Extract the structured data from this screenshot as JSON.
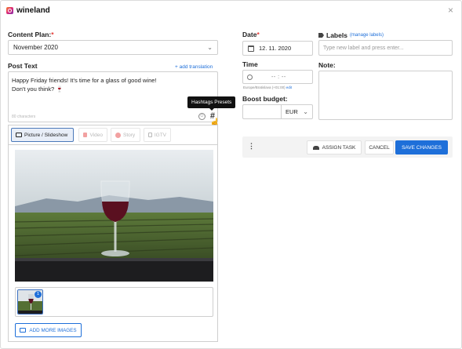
{
  "header": {
    "brand_icon": "instagram-icon",
    "brand_name": "wineland",
    "close_icon": "close-icon",
    "close_glyph": "×"
  },
  "content_plan": {
    "label": "Content Plan:",
    "required_mark": "*",
    "value": "November 2020"
  },
  "post_text": {
    "label": "Post Text",
    "add_translation": "+ add translation",
    "line1": "Happy Friday friends! It's time for a glass of good wine!",
    "line2": "Don't you think? 🍷",
    "char_count": "80 characters",
    "emoji_icon": "emoji-icon",
    "hashtag_icon": "hashtag-icon",
    "hashtag_glyph": "#",
    "tooltip": "Hashtags Presets"
  },
  "media_tabs": [
    {
      "label": "Picture / Slideshow",
      "active": true,
      "icon": "image-icon"
    },
    {
      "label": "Video",
      "active": false,
      "icon": "video-icon"
    },
    {
      "label": "Story",
      "active": false,
      "icon": "story-icon"
    },
    {
      "label": "IGTV",
      "active": false,
      "icon": "igtv-icon"
    }
  ],
  "media": {
    "thumb_badge": "1",
    "add_more_label": "ADD MORE IMAGES"
  },
  "date": {
    "label": "Date",
    "required_mark": "*",
    "value": "12. 11. 2020"
  },
  "time": {
    "label": "Time",
    "value": "-- : --",
    "timezone": "Europe/Bratislava (+01:00)",
    "timezone_edit": "edit"
  },
  "budget": {
    "label": "Boost budget:",
    "currency": "EUR"
  },
  "labels": {
    "label": "Labels",
    "manage": "(manage labels)",
    "placeholder": "Type new label and press enter..."
  },
  "note": {
    "label": "Note:"
  },
  "actions": {
    "more_glyph": "⋮",
    "assign": "ASSIGN TASK",
    "cancel": "CANCEL",
    "save": "SAVE CHANGES"
  },
  "colors": {
    "primary": "#1e6fd9",
    "required": "#e53935",
    "tooltip_bg": "#111111"
  }
}
